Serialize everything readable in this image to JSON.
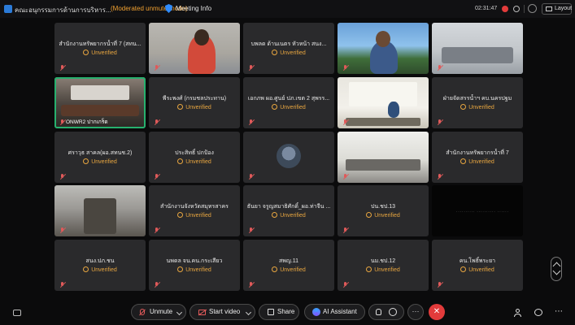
{
  "topbar": {
    "meeting_title": "คณะอนุกรรมการด้านการบริหาร...",
    "mode": "(Moderated unmute mode)",
    "meeting_info": "Meeting Info",
    "clock": "02:31:47",
    "layout_label": "Layout"
  },
  "tiles": [
    {
      "name": "สำนักงานทรัพยากรน้ำที่ 7 (สทน...",
      "status": "Unverified"
    },
    {
      "name": "",
      "status": ""
    },
    {
      "name": "บพลด ด้านเนตร หัวหน้า สนง...",
      "status": "Unverified"
    },
    {
      "name": "",
      "status": ""
    },
    {
      "name": "",
      "status": ""
    },
    {
      "name": "",
      "status": "",
      "label": "ONWR2 ปากเกร็ด"
    },
    {
      "name": "พีระพงศ์ (กรมชลประทาน)",
      "status": "Unverified"
    },
    {
      "name": "เอกภพ ผอ.ศูนย์ ปภ.เขต 2 สุพรร...",
      "status": "Unverified"
    },
    {
      "name": "",
      "status": ""
    },
    {
      "name": "ฝ่ายจัดสรรน้ำฯ คบ.นครปฐม",
      "status": "Unverified"
    },
    {
      "name": "ศราวุธ สาคล(ผอ.สทนช.2)",
      "status": "Unverified"
    },
    {
      "name": "ประสิทธิ์ ปกป้อง",
      "status": "Unverified"
    },
    {
      "name": "",
      "status": ""
    },
    {
      "name": "",
      "status": ""
    },
    {
      "name": "สำนักงานทรัพยากรน้ำที่ 7",
      "status": "Unverified"
    },
    {
      "name": "",
      "status": ""
    },
    {
      "name": "สำนักงานจังหวัดสมุทรสาคร",
      "status": "Unverified"
    },
    {
      "name": "ธันยา จรูญสมาธิศักดิ์_ผอ.ท่าจีน ...",
      "status": "Unverified"
    },
    {
      "name": "ปน.ชป.13",
      "status": "Unverified"
    },
    {
      "name": "",
      "status": ""
    },
    {
      "name": "สนง.ปภ.ชน",
      "status": "Unverified"
    },
    {
      "name": "นพดล จน.คน.กระเสียว",
      "status": "Unverified"
    },
    {
      "name": "สพญ.11",
      "status": "Unverified"
    },
    {
      "name": "นม.ชป.12",
      "status": "Unverified"
    },
    {
      "name": "คน.โพธิ์พระยา",
      "status": "Unverified"
    }
  ],
  "controls": {
    "unmute": "Unmute",
    "start_video": "Start video",
    "share": "Share",
    "ai_assistant": "AI Assistant",
    "more": "···"
  },
  "colors": {
    "accent_unverified": "#e8a640",
    "end_call": "#e23b3b",
    "active_speaker": "#27b06e",
    "mode_text": "#f0a030"
  }
}
